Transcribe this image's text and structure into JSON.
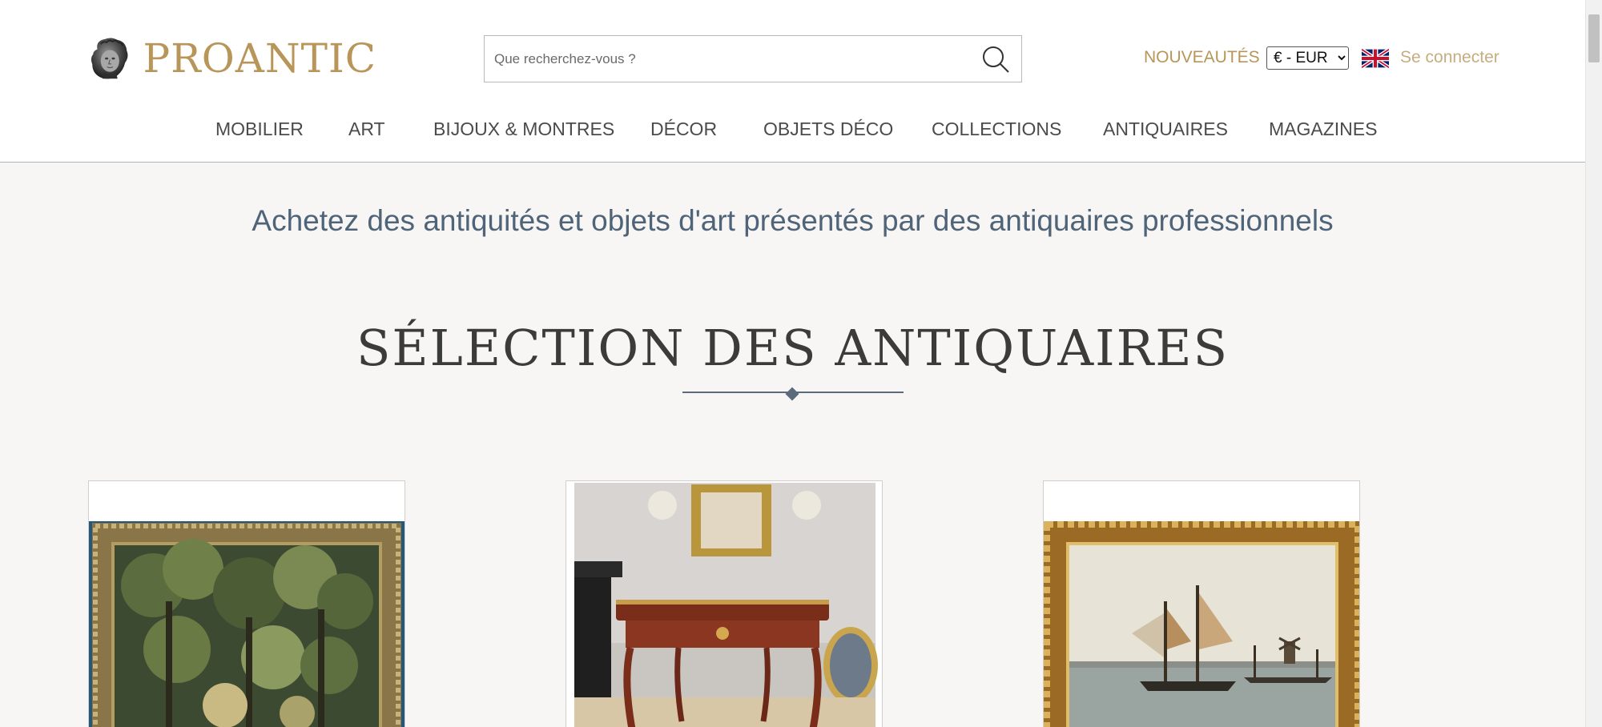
{
  "header": {
    "logo_text": "PROANTIC",
    "search_placeholder": "Que recherchez-vous ?",
    "new_label": "NOUVEAUTÉS",
    "currency": {
      "selected": "€ - EUR",
      "options": [
        "€ - EUR"
      ]
    },
    "language_flag": "uk-flag-icon",
    "login_label": "Se connecter"
  },
  "nav": {
    "items": [
      {
        "label": "MOBILIER"
      },
      {
        "label": "ART"
      },
      {
        "label": "BIJOUX & MONTRES"
      },
      {
        "label": "DÉCOR"
      },
      {
        "label": "OBJETS DÉCO"
      },
      {
        "label": "COLLECTIONS"
      },
      {
        "label": "ANTIQUAIRES"
      },
      {
        "label": "MAGAZINES"
      }
    ]
  },
  "main": {
    "tagline": "Achetez des antiquités et objets d'art présentés par des antiquaires professionnels",
    "section_title": "SÉLECTION DES ANTIQUAIRES",
    "cards": [
      {
        "image": "tapestry-image"
      },
      {
        "image": "desk-image"
      },
      {
        "image": "seascape-painting-image"
      }
    ]
  },
  "colors": {
    "brand_gold": "#b89559",
    "login_gold": "#c5ad80",
    "tagline_blue": "#4f6478",
    "page_bg": "#f7f6f4"
  }
}
